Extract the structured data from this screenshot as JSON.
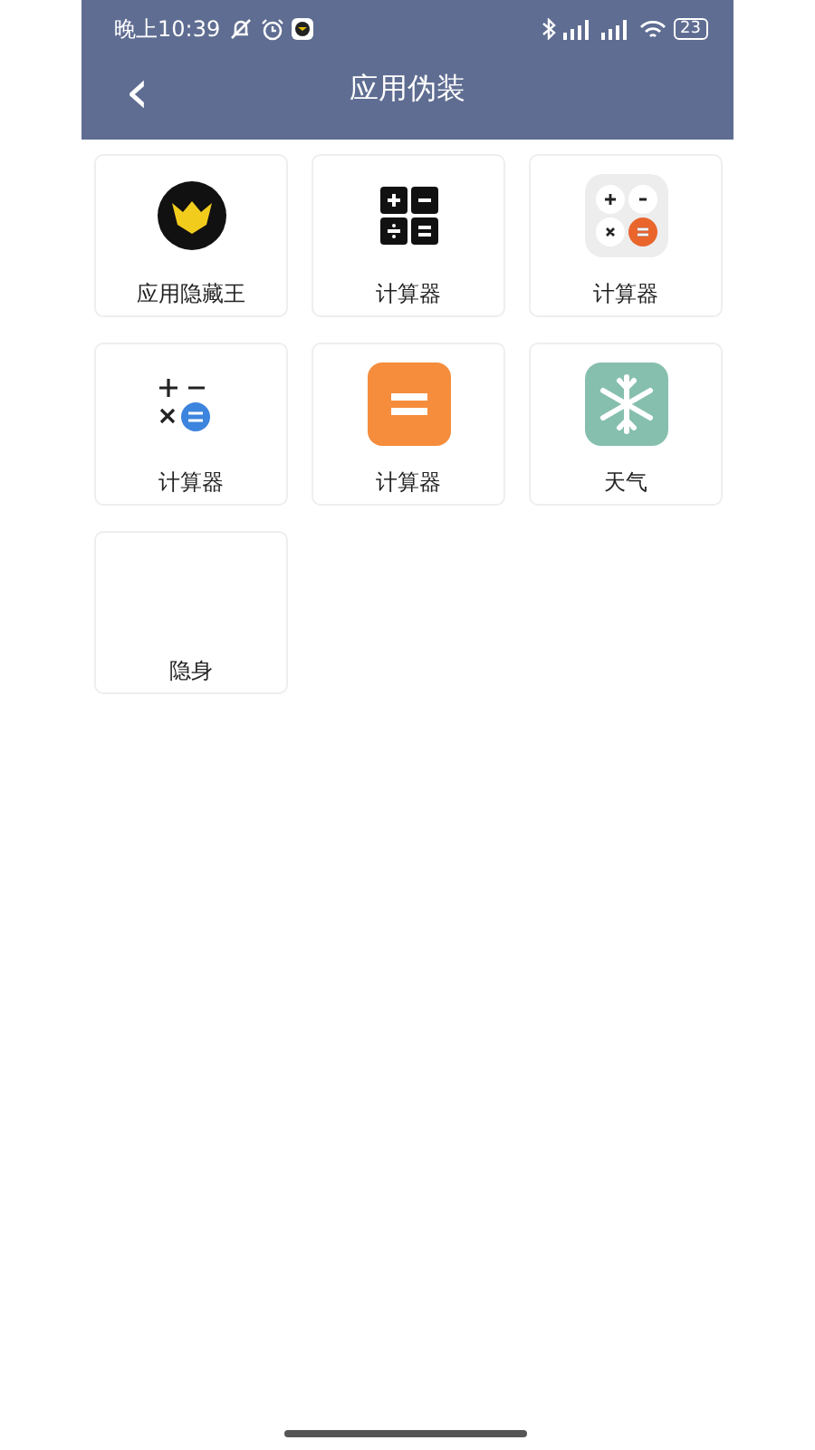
{
  "status_bar": {
    "time": "晚上10:39",
    "battery": "23"
  },
  "header": {
    "back": "‹",
    "title": "应用伪装"
  },
  "apps": [
    {
      "kind": "crown",
      "label": "应用隐藏王"
    },
    {
      "kind": "calc-dark",
      "label": "计算器"
    },
    {
      "kind": "calc-light",
      "label": "计算器"
    },
    {
      "kind": "calc-plain",
      "label": "计算器"
    },
    {
      "kind": "calc-orange",
      "label": "计算器"
    },
    {
      "kind": "snowflake",
      "label": "天气"
    },
    {
      "kind": "blank",
      "label": "隐身"
    }
  ]
}
